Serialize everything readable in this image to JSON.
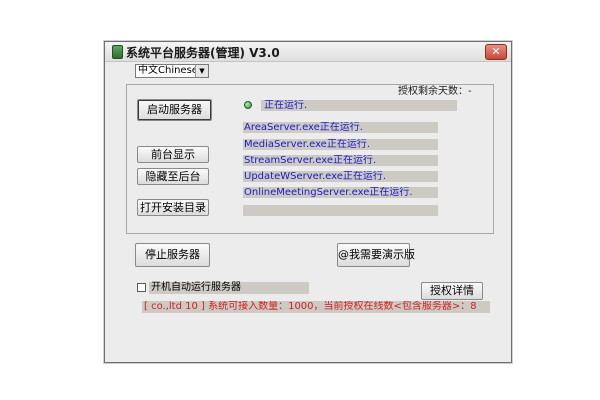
{
  "window": {
    "title": "系统平台服务器(管理) V3.0",
    "close_glyph": "✕"
  },
  "language": {
    "selected": "中文Chinese",
    "arrow_glyph": "▼"
  },
  "license": {
    "remaining_days_label": "授权剩余天数：-",
    "detail_button": "授权详情"
  },
  "left_buttons": {
    "start_service": "启动服务器",
    "show_foreground": "前台显示",
    "hide_background": "隐藏至后台",
    "open_install_dir": "打开安装目录"
  },
  "status": {
    "main": "正在运行.",
    "services": [
      "AreaServer.exe正在运行.",
      "MediaServer.exe正在运行.",
      "StreamServer.exe正在运行.",
      "UpdateWServer.exe正在运行.",
      "OnlineMeetingServer.exe正在运行.",
      ""
    ]
  },
  "bottom": {
    "stop_service": "停止服务器",
    "demo_button": "@我需要演示版",
    "autostart_label": "开机自动运行服务器",
    "autostart_checked": false,
    "info_text": "[ co.,ltd 10 ] 系统可接入数量：1000，当前授权在线数<包含服务器>：8"
  },
  "colors": {
    "status_text": "#1a1acd",
    "info_text": "#d02020",
    "status_bg": "#cdcac4"
  }
}
